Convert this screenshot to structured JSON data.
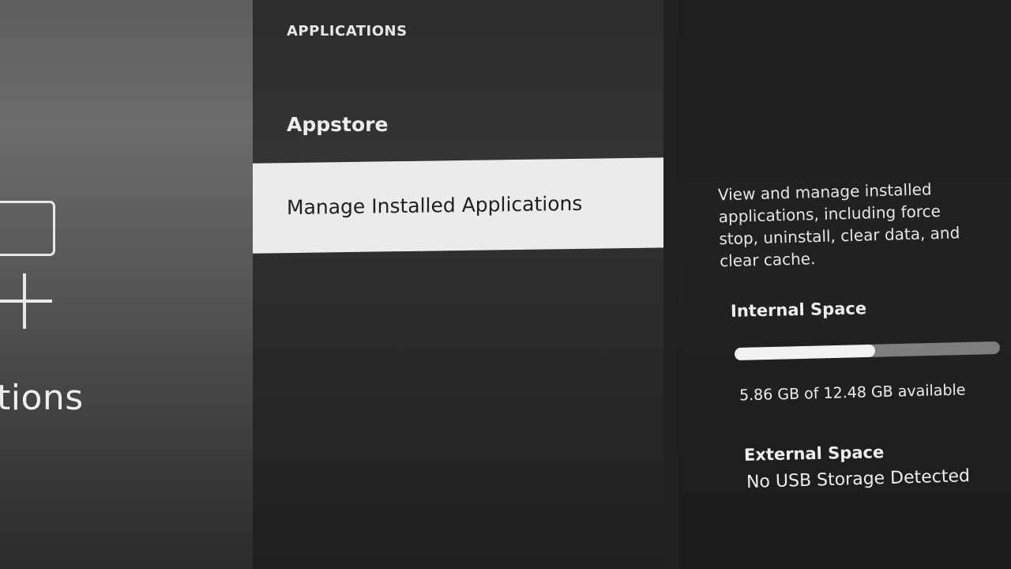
{
  "left_panel": {
    "label": "tions"
  },
  "menu": {
    "header": "APPLICATIONS",
    "items": [
      {
        "label": "Appstore",
        "selected": false
      },
      {
        "label": "Manage Installed Applications",
        "selected": true
      }
    ]
  },
  "info": {
    "description": "View and manage installed applications, including force stop, uninstall, clear data, and clear cache.",
    "internal": {
      "title": "Internal Space",
      "available_gb": 5.86,
      "total_gb": 12.48,
      "used_fraction": 0.53,
      "text": "5.86 GB of 12.48 GB available"
    },
    "external": {
      "title": "External Space",
      "status": "No USB Storage Detected"
    }
  },
  "colors": {
    "selected_bg": "#ebebeb",
    "progress_fill": "#f2f2f2",
    "progress_track": "#7c7e80"
  },
  "icons": [
    "screen-outline-icon",
    "plus-icon"
  ]
}
